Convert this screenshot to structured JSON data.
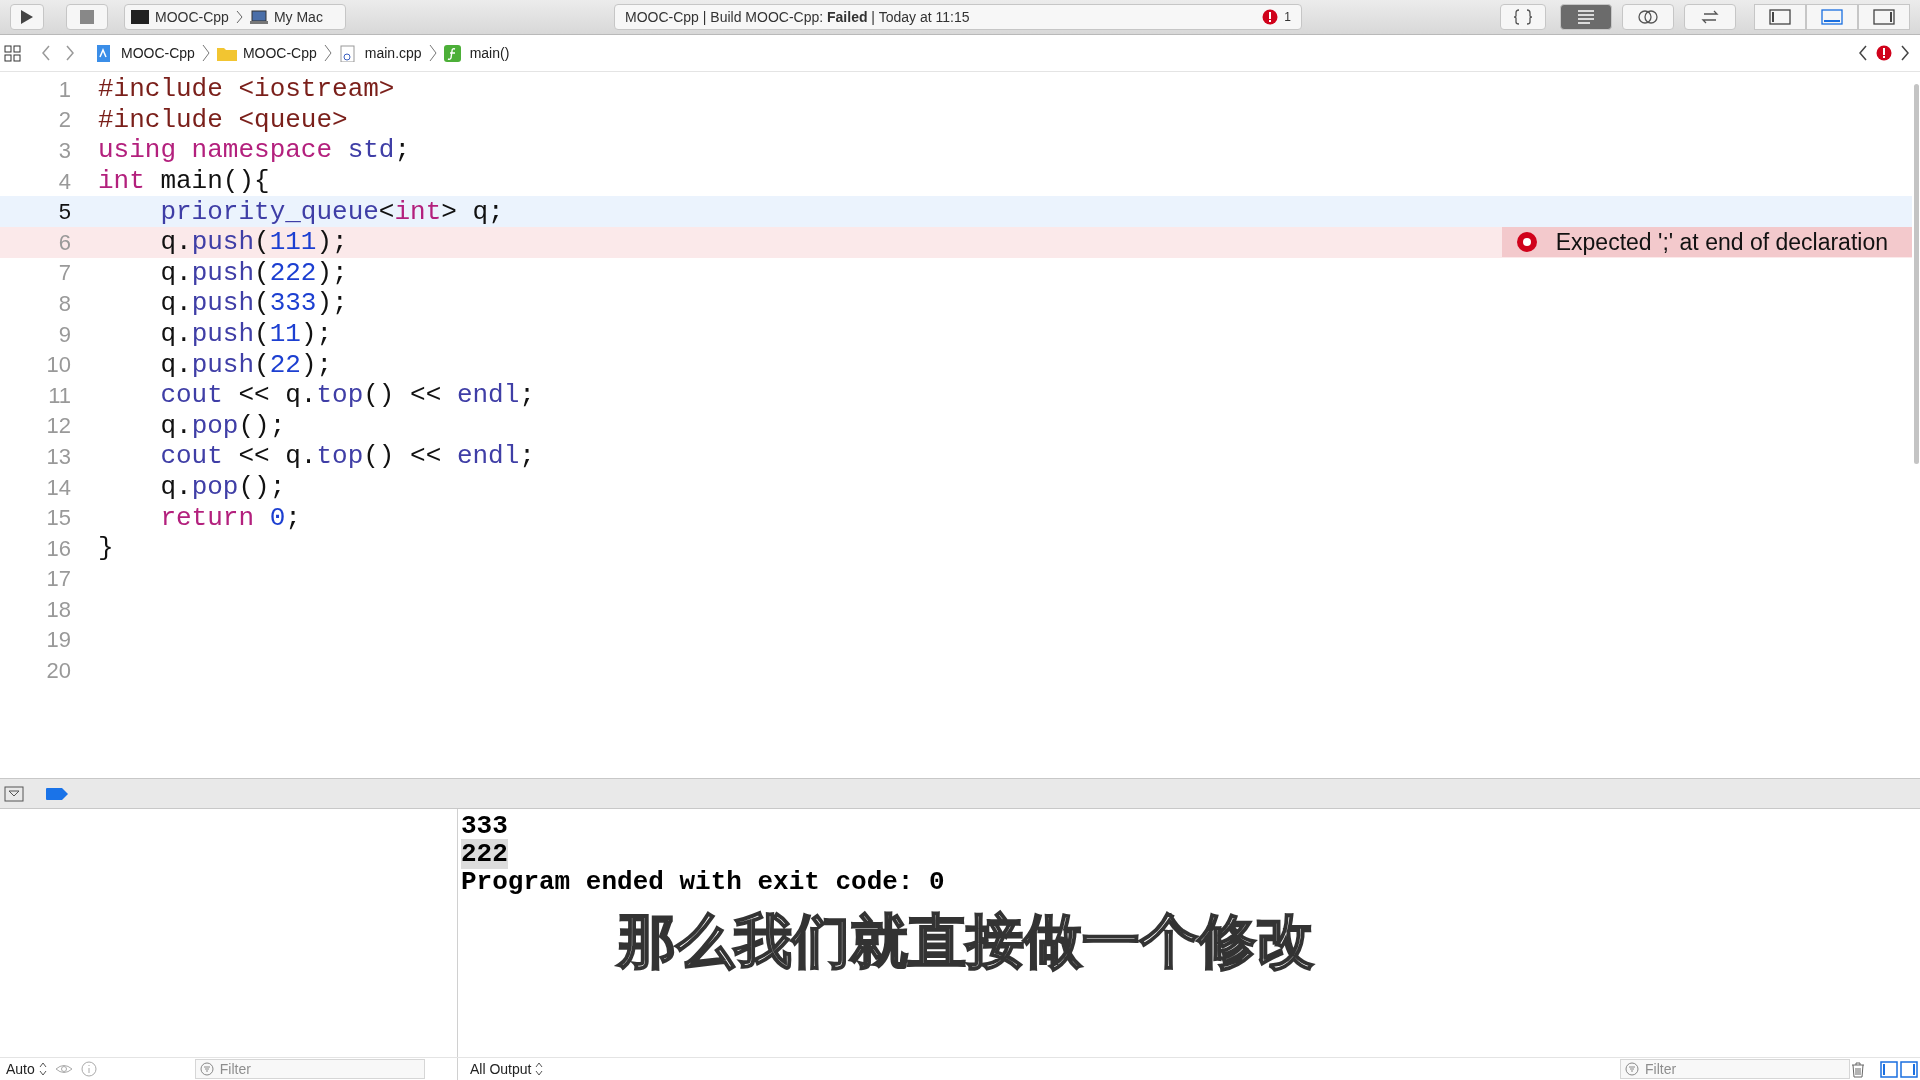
{
  "toolbar": {
    "scheme": "MOOC-Cpp",
    "destination": "My Mac",
    "activity": "MOOC-Cpp | Build MOOC-Cpp: **Failed** | Today at 11:15",
    "error_count": "1",
    "editor_modes": [
      {
        "kind": "braces",
        "selected": false
      },
      {
        "kind": "standard",
        "selected": true
      },
      {
        "kind": "assistant",
        "selected": false
      },
      {
        "kind": "version",
        "selected": false
      }
    ],
    "panels": [
      {
        "kind": "navigator",
        "selected": false
      },
      {
        "kind": "debug",
        "selected": true
      },
      {
        "kind": "utilities",
        "selected": false
      }
    ]
  },
  "breadcrumb": [
    {
      "kind": "project",
      "label": "MOOC-Cpp"
    },
    {
      "kind": "folder",
      "label": "MOOC-Cpp"
    },
    {
      "kind": "file",
      "label": "main.cpp"
    },
    {
      "kind": "function",
      "label": "main()"
    }
  ],
  "editor": {
    "lines": [
      {
        "number": "1",
        "current": false,
        "tokens": [
          {
            "kind": "directive",
            "text": "#include <iostream>"
          }
        ]
      },
      {
        "number": "2",
        "current": false,
        "tokens": [
          {
            "kind": "directive",
            "text": "#include <queue>"
          }
        ]
      },
      {
        "number": "3",
        "current": false,
        "tokens": [
          {
            "kind": "keyword",
            "text": "using namespace "
          },
          {
            "kind": "library",
            "text": "std"
          },
          {
            "kind": "plain",
            "text": ";"
          }
        ]
      },
      {
        "number": "4",
        "current": false,
        "tokens": [
          {
            "kind": "keyword",
            "text": "int"
          },
          {
            "kind": "plain",
            "text": " main(){"
          }
        ]
      },
      {
        "number": "5",
        "current": true,
        "tokens": [
          {
            "kind": "library",
            "text": "    priority_queue"
          },
          {
            "kind": "plain",
            "text": "<"
          },
          {
            "kind": "keyword",
            "text": "int"
          },
          {
            "kind": "plain",
            "text": "> q;"
          }
        ]
      },
      {
        "number": "6",
        "current": false,
        "issue": "Expected ';' at end of declaration",
        "tokens": [
          {
            "kind": "plain",
            "text": "    q."
          },
          {
            "kind": "library",
            "text": "push"
          },
          {
            "kind": "plain",
            "text": "("
          },
          {
            "kind": "number",
            "text": "111"
          },
          {
            "kind": "plain",
            "text": ");"
          }
        ]
      },
      {
        "number": "7",
        "current": false,
        "tokens": [
          {
            "kind": "plain",
            "text": "    q."
          },
          {
            "kind": "library",
            "text": "push"
          },
          {
            "kind": "plain",
            "text": "("
          },
          {
            "kind": "number",
            "text": "222"
          },
          {
            "kind": "plain",
            "text": ");"
          }
        ]
      },
      {
        "number": "8",
        "current": false,
        "tokens": [
          {
            "kind": "plain",
            "text": "    q."
          },
          {
            "kind": "library",
            "text": "push"
          },
          {
            "kind": "plain",
            "text": "("
          },
          {
            "kind": "number",
            "text": "333"
          },
          {
            "kind": "plain",
            "text": ");"
          }
        ]
      },
      {
        "number": "9",
        "current": false,
        "tokens": [
          {
            "kind": "plain",
            "text": "    q."
          },
          {
            "kind": "library",
            "text": "push"
          },
          {
            "kind": "plain",
            "text": "("
          },
          {
            "kind": "number",
            "text": "11"
          },
          {
            "kind": "plain",
            "text": ");"
          }
        ]
      },
      {
        "number": "10",
        "current": false,
        "tokens": [
          {
            "kind": "plain",
            "text": "    q."
          },
          {
            "kind": "library",
            "text": "push"
          },
          {
            "kind": "plain",
            "text": "("
          },
          {
            "kind": "number",
            "text": "22"
          },
          {
            "kind": "plain",
            "text": ");"
          }
        ]
      },
      {
        "number": "11",
        "current": false,
        "tokens": [
          {
            "kind": "library",
            "text": "    cout"
          },
          {
            "kind": "plain",
            "text": " << q."
          },
          {
            "kind": "library",
            "text": "top"
          },
          {
            "kind": "plain",
            "text": "() << "
          },
          {
            "kind": "library",
            "text": "endl"
          },
          {
            "kind": "plain",
            "text": ";"
          }
        ]
      },
      {
        "number": "12",
        "current": false,
        "tokens": [
          {
            "kind": "plain",
            "text": "    q."
          },
          {
            "kind": "library",
            "text": "pop"
          },
          {
            "kind": "plain",
            "text": "();"
          }
        ]
      },
      {
        "number": "13",
        "current": false,
        "tokens": [
          {
            "kind": "library",
            "text": "    cout"
          },
          {
            "kind": "plain",
            "text": " << q."
          },
          {
            "kind": "library",
            "text": "top"
          },
          {
            "kind": "plain",
            "text": "() << "
          },
          {
            "kind": "library",
            "text": "endl"
          },
          {
            "kind": "plain",
            "text": ";"
          }
        ]
      },
      {
        "number": "14",
        "current": false,
        "tokens": [
          {
            "kind": "plain",
            "text": "    q."
          },
          {
            "kind": "library",
            "text": "pop"
          },
          {
            "kind": "plain",
            "text": "();"
          }
        ]
      },
      {
        "number": "15",
        "current": false,
        "tokens": [
          {
            "kind": "keyword",
            "text": "    return "
          },
          {
            "kind": "number",
            "text": "0"
          },
          {
            "kind": "plain",
            "text": ";"
          }
        ]
      },
      {
        "number": "16",
        "current": false,
        "tokens": [
          {
            "kind": "plain",
            "text": "}"
          }
        ]
      },
      {
        "number": "17",
        "current": false
      },
      {
        "number": "18",
        "current": false
      },
      {
        "number": "19",
        "current": false
      },
      {
        "number": "20",
        "current": false
      }
    ]
  },
  "console": {
    "lines": [
      {
        "text": "333",
        "selected": false
      },
      {
        "text": "222",
        "selected": true
      },
      {
        "text": "Program ended with exit code: 0",
        "selected": false
      }
    ]
  },
  "subtitle": "那么我们就直接做一个修改",
  "bottom_bar": {
    "variables_mode": "Auto",
    "variables_filter": {
      "placeholder": "Filter"
    },
    "output_mode": "All Output",
    "console_filter": {
      "placeholder": "Filter"
    }
  }
}
